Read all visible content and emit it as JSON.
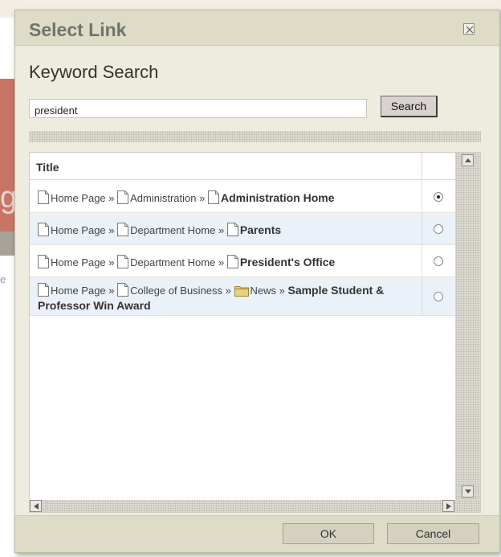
{
  "dialog": {
    "title": "Select Link",
    "keyword_heading": "Keyword Search",
    "search": {
      "value": "president",
      "button_label": "Search"
    },
    "table": {
      "header_title": "Title",
      "rows": [
        {
          "crumbs": [
            "Home Page »",
            "Administration »"
          ],
          "target": "Administration Home",
          "selected": true
        },
        {
          "crumbs": [
            "Home Page »",
            "Department Home »"
          ],
          "target": "Parents",
          "selected": false
        },
        {
          "crumbs": [
            "Home Page »",
            "Department Home »"
          ],
          "target": "President's Office",
          "selected": false
        },
        {
          "crumbs": [
            "Home Page »",
            "College of Business »",
            "News »"
          ],
          "target": "Sample Student & Professor Win Award",
          "selected": false
        }
      ]
    },
    "footer": {
      "ok_label": "OK",
      "cancel_label": "Cancel"
    }
  },
  "background": {
    "letter_g": "g",
    "letter_e": "e"
  },
  "icons": {
    "close": "close-icon",
    "page": "page-icon",
    "folder": "folder-icon",
    "scroll_up": "arrow-up-icon",
    "scroll_down": "arrow-down-icon",
    "scroll_left": "arrow-left-icon",
    "scroll_right": "arrow-right-icon"
  },
  "colors": {
    "title_bar": "#dedbc6",
    "dialog_bg": "#eeecdf",
    "row_alt": "#eaf1f9",
    "title_text": "#6f7569"
  }
}
